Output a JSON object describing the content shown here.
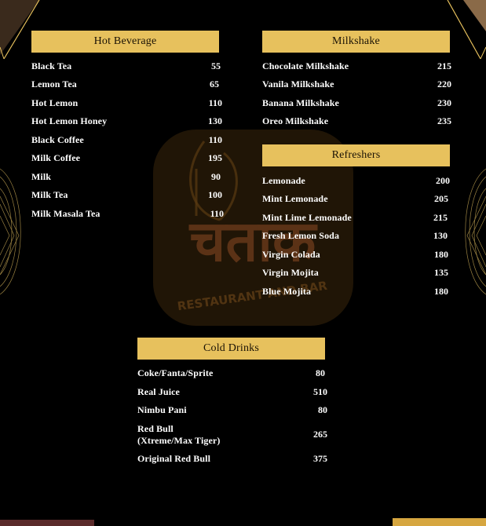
{
  "brand": {
    "logo_text": "चताक",
    "tagline": "RESTAURANT AND BAR"
  },
  "colors": {
    "background": "#000000",
    "header_gold": "#e7c15d",
    "header_text": "#1a1205",
    "item_text": "#ffffff"
  },
  "sections": {
    "hot_beverage": {
      "title": "Hot Beverage",
      "items": [
        {
          "name": "Black Tea",
          "price": "55"
        },
        {
          "name": "Lemon Tea",
          "price": "65"
        },
        {
          "name": "Hot Lemon",
          "price": "110"
        },
        {
          "name": "Hot Lemon Honey",
          "price": "130"
        },
        {
          "name": "Black Coffee",
          "price": "110"
        },
        {
          "name": "Milk Coffee",
          "price": "195"
        },
        {
          "name": "Milk",
          "price": "90"
        },
        {
          "name": "Milk Tea",
          "price": "100"
        },
        {
          "name": "Milk Masala Tea",
          "price": "110"
        }
      ]
    },
    "milkshake": {
      "title": "Milkshake",
      "items": [
        {
          "name": "Chocolate Milkshake",
          "price": "215"
        },
        {
          "name": "Vanila Milkshake",
          "price": "220"
        },
        {
          "name": "Banana Milkshake",
          "price": "230"
        },
        {
          "name": "Oreo Milkshake",
          "price": "235"
        }
      ]
    },
    "refreshers": {
      "title": "Refreshers",
      "items": [
        {
          "name": "Lemonade",
          "price": "200"
        },
        {
          "name": "Mint Lemonade",
          "price": "205"
        },
        {
          "name": "Mint Lime Lemonade",
          "price": "215"
        },
        {
          "name": "Fresh Lemon Soda",
          "price": "130"
        },
        {
          "name": "Virgin Colada",
          "price": "180"
        },
        {
          "name": "Virgin Mojita",
          "price": "135"
        },
        {
          "name": "Blue Mojita",
          "price": "180"
        }
      ]
    },
    "cold_drinks": {
      "title": "Cold Drinks",
      "items": [
        {
          "name": "Coke/Fanta/Sprite",
          "price": "80"
        },
        {
          "name": "Real Juice",
          "price": "510"
        },
        {
          "name": "Nimbu Pani",
          "price": "80"
        },
        {
          "name": "Red Bull",
          "name2": "(Xtreme/Max Tiger)",
          "price": "265"
        },
        {
          "name": "Original Red Bull",
          "price": "375"
        }
      ]
    }
  }
}
